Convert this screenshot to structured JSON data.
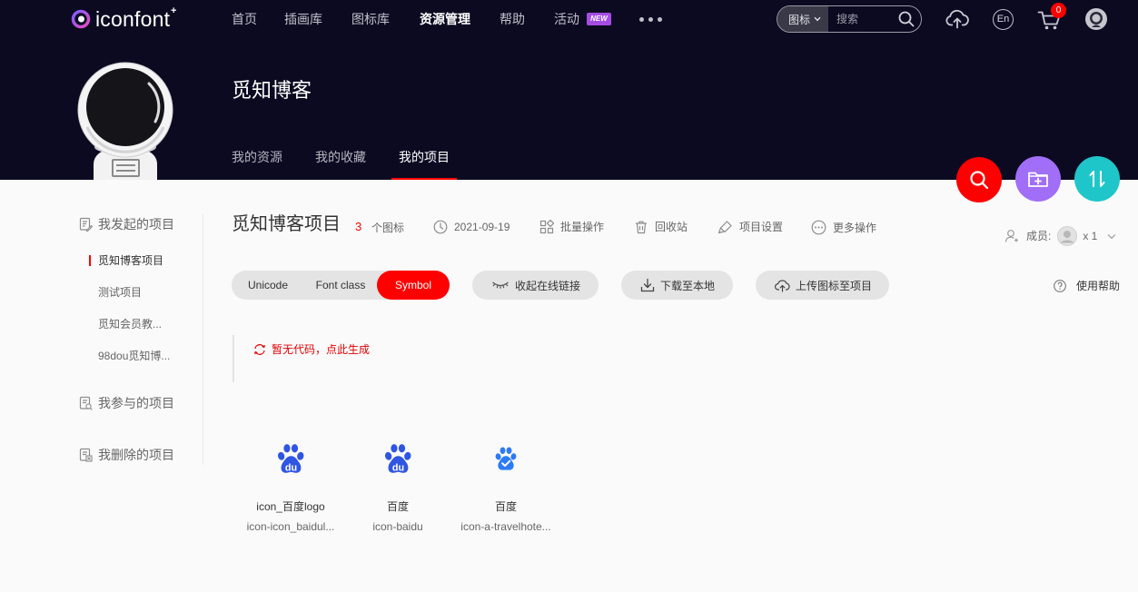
{
  "colors": {
    "header_bg": "#0c0a21",
    "accent_red": "#ff0000",
    "badge_purple": "#a54ce4",
    "fab_purple": "#a06ef7",
    "fab_teal": "#1fc6c9",
    "baidu_blue": "#2f55e4",
    "baidu_light_blue": "#2d7bf4"
  },
  "nav": {
    "logo": "iconfont",
    "logo_plus": "+",
    "items": [
      {
        "label": "首页"
      },
      {
        "label": "插画库"
      },
      {
        "label": "图标库"
      },
      {
        "label": "资源管理",
        "active": true
      },
      {
        "label": "帮助"
      },
      {
        "label": "活动",
        "badge": "NEW"
      }
    ],
    "more_icon": "more-dots-icon",
    "search": {
      "scope": "图标",
      "placeholder": "搜索"
    },
    "language": "En",
    "cart_count": "0",
    "icons": [
      "upload-cloud-icon",
      "language-icon",
      "cart-icon",
      "user-avatar-icon"
    ]
  },
  "profile": {
    "name": "觅知博客",
    "avatar": "astronaut-avatar-icon",
    "tabs": [
      {
        "label": "我的资源"
      },
      {
        "label": "我的收藏"
      },
      {
        "label": "我的项目",
        "active": true
      }
    ]
  },
  "fab": [
    {
      "icon": "search-icon"
    },
    {
      "icon": "add-folder-icon"
    },
    {
      "icon": "sort-icon"
    }
  ],
  "sidebar": {
    "created": {
      "title": "我发起的项目",
      "items": [
        {
          "label": "觅知博客项目",
          "active": true
        },
        {
          "label": "测试项目"
        },
        {
          "label": "觅知会员教..."
        },
        {
          "label": "98dou觅知博..."
        }
      ]
    },
    "joined": {
      "title": "我参与的项目"
    },
    "deleted": {
      "title": "我删除的项目"
    }
  },
  "project": {
    "title": "觅知博客项目",
    "icon_count": "3",
    "icon_count_unit": "个图标",
    "date": "2021-09-19",
    "actions": {
      "batch": "批量操作",
      "recycle": "回收站",
      "settings": "项目设置",
      "more": "更多操作"
    },
    "members_label": "成员:",
    "members_count": "x 1"
  },
  "toolbar": {
    "formats": [
      {
        "label": "Unicode"
      },
      {
        "label": "Font class"
      },
      {
        "label": "Symbol",
        "active": true
      }
    ],
    "collapse_link": "收起在线链接",
    "download": "下载至本地",
    "upload": "上传图标至项目",
    "help": "使用帮助"
  },
  "code_panel": {
    "message": "暂无代码，点此生成"
  },
  "icons": [
    {
      "name": "icon_百度logo",
      "code": "icon-icon_baidul...",
      "glyph": "baidu-logo-icon",
      "logo_text": "du"
    },
    {
      "name": "百度",
      "code": "icon-baidu",
      "glyph": "baidu-logo-icon",
      "logo_text": "du"
    },
    {
      "name": "百度",
      "code": "icon-a-travelhote...",
      "glyph": "baidu-paw-check-icon"
    }
  ]
}
